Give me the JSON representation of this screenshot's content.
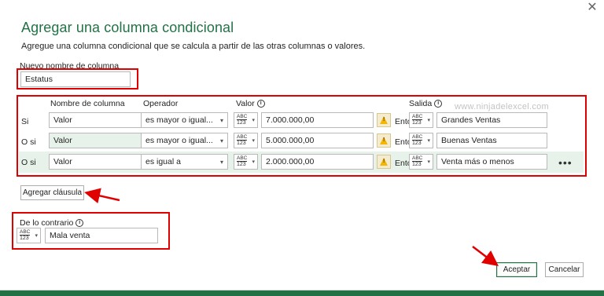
{
  "dialog": {
    "title": "Agregar una columna condicional",
    "description": "Agregue una columna condicional que se calcula a partir de las otras columnas o valores.",
    "close_glyph": "✕"
  },
  "column_name": {
    "label": "Nuevo nombre de columna",
    "value": "Estatus"
  },
  "headers": {
    "column": "Nombre de columna",
    "operator": "Operador",
    "value": "Valor",
    "output": "Salida"
  },
  "watermark": "www.ninjadelexcel.com",
  "type_icon": {
    "top": "ABC",
    "bottom": "123"
  },
  "rows": [
    {
      "prefix": "Si",
      "column": "Valor",
      "operator": "es mayor o igual...",
      "value": "7.000.000,00",
      "then": "Enton...",
      "output": "Grandes Ventas"
    },
    {
      "prefix": "O si",
      "column": "Valor",
      "operator": "es mayor o igual...",
      "value": "5.000.000,00",
      "then": "Enton...",
      "output": "Buenas Ventas"
    },
    {
      "prefix": "O si",
      "column": "Valor",
      "operator": "es igual a",
      "value": "2.000.000,00",
      "then": "Enton...",
      "output": "Venta más o menos",
      "more": "•••"
    }
  ],
  "add_clause": "Agregar cláusula",
  "else": {
    "label": "De lo contrario",
    "value": "Mala venta"
  },
  "footer": {
    "ok": "Aceptar",
    "cancel": "Cancelar"
  },
  "colors": {
    "accent": "#217346",
    "annotation_red": "#e00000",
    "row_highlight": "#e6f2ea"
  }
}
